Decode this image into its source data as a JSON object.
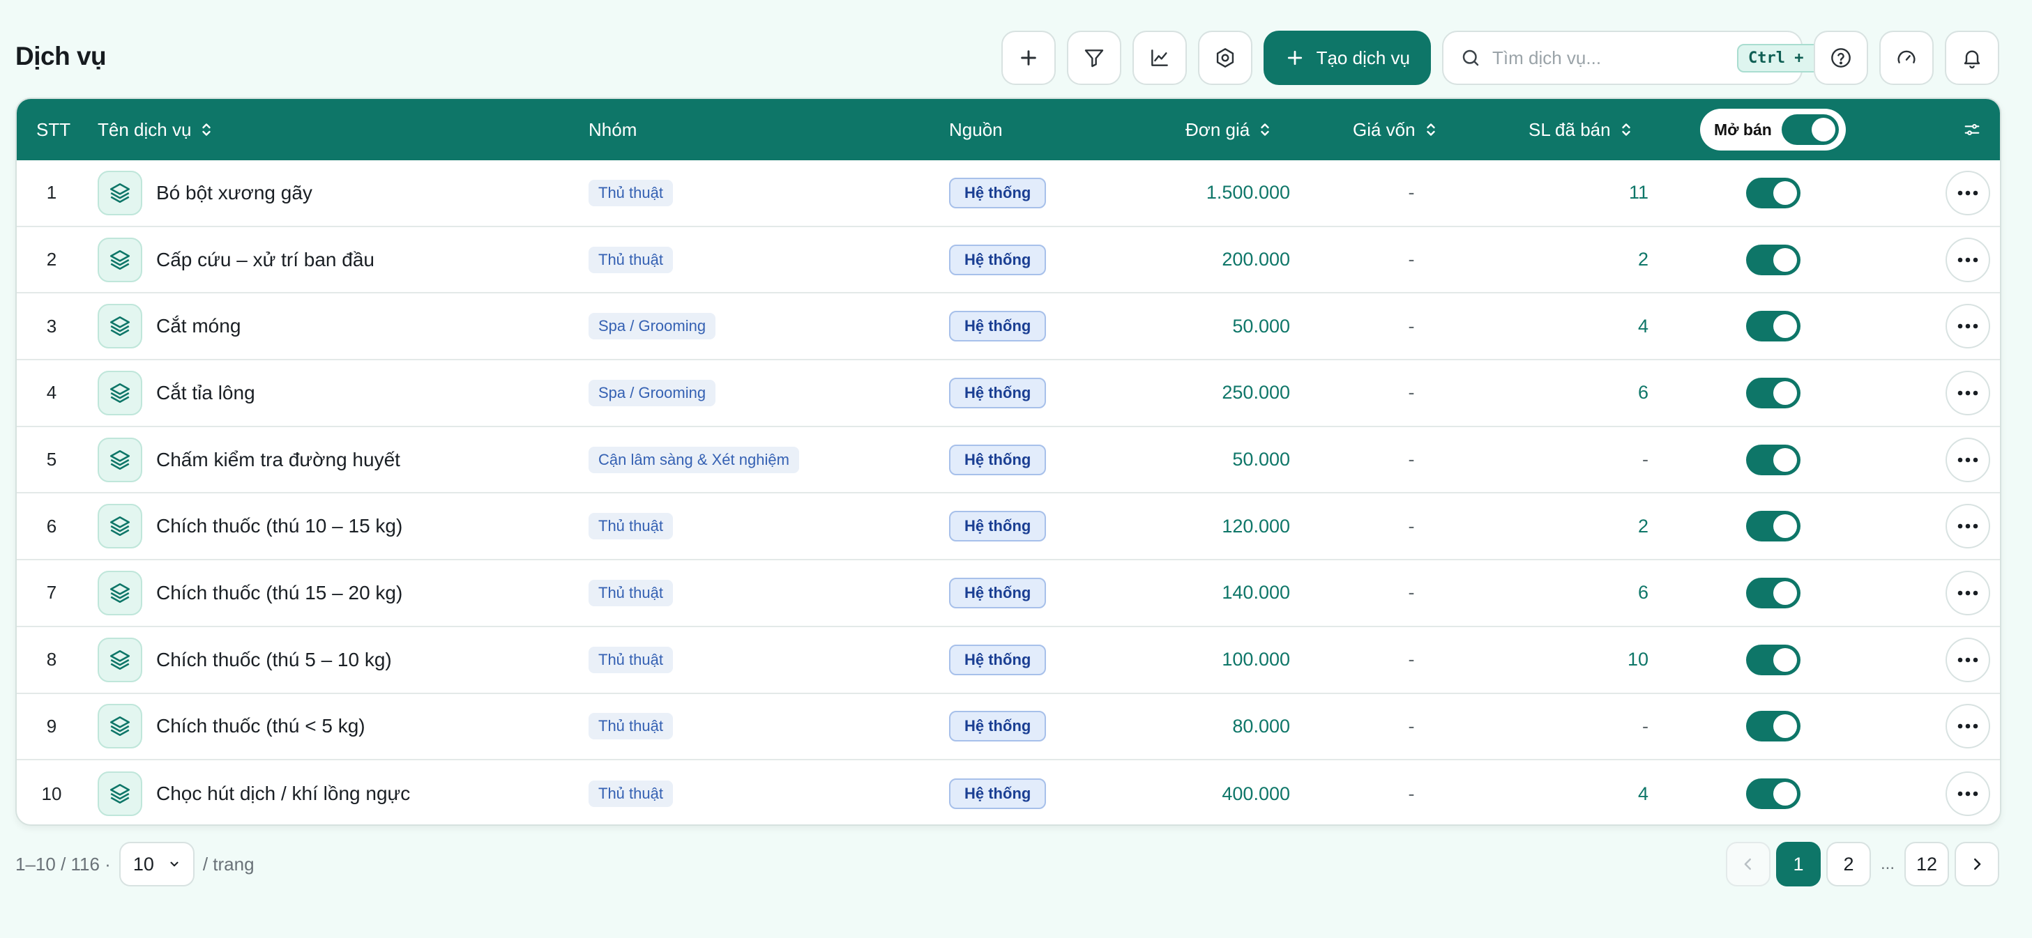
{
  "page": {
    "title": "Dịch vụ"
  },
  "toolbar": {
    "add_icon": "plus-icon",
    "filter_icon": "filter-icon",
    "chart_icon": "line-chart-icon",
    "settings_icon": "settings-hex-icon",
    "create_label": "Tạo dịch vụ",
    "search_placeholder": "Tìm dịch vụ...",
    "search_shortcut": "Ctrl + K",
    "help_icon": "help-circle-icon",
    "gauge_icon": "gauge-icon",
    "bell_icon": "bell-icon"
  },
  "table": {
    "headers": {
      "stt": "STT",
      "name": "Tên dịch vụ",
      "group": "Nhóm",
      "source": "Nguồn",
      "price": "Đơn giá",
      "cost": "Giá vốn",
      "sold": "SL đã bán",
      "open": "Mở bán"
    },
    "rows": [
      {
        "stt": "1",
        "name": "Bó bột xương gãy",
        "group": "Thủ thuật",
        "source": "Hệ thống",
        "price": "1.500.000",
        "cost": "-",
        "sold": "11",
        "open": true
      },
      {
        "stt": "2",
        "name": "Cấp cứu – xử trí ban đầu",
        "group": "Thủ thuật",
        "source": "Hệ thống",
        "price": "200.000",
        "cost": "-",
        "sold": "2",
        "open": true
      },
      {
        "stt": "3",
        "name": "Cắt móng",
        "group": "Spa / Grooming",
        "source": "Hệ thống",
        "price": "50.000",
        "cost": "-",
        "sold": "4",
        "open": true
      },
      {
        "stt": "4",
        "name": "Cắt tỉa lông",
        "group": "Spa / Grooming",
        "source": "Hệ thống",
        "price": "250.000",
        "cost": "-",
        "sold": "6",
        "open": true
      },
      {
        "stt": "5",
        "name": "Chấm kiểm tra đường huyết",
        "group": "Cận lâm sàng & Xét nghiệm",
        "source": "Hệ thống",
        "price": "50.000",
        "cost": "-",
        "sold": "-",
        "open": true
      },
      {
        "stt": "6",
        "name": "Chích thuốc (thú 10 – 15 kg)",
        "group": "Thủ thuật",
        "source": "Hệ thống",
        "price": "120.000",
        "cost": "-",
        "sold": "2",
        "open": true
      },
      {
        "stt": "7",
        "name": "Chích thuốc (thú 15 – 20 kg)",
        "group": "Thủ thuật",
        "source": "Hệ thống",
        "price": "140.000",
        "cost": "-",
        "sold": "6",
        "open": true
      },
      {
        "stt": "8",
        "name": "Chích thuốc (thú 5 – 10 kg)",
        "group": "Thủ thuật",
        "source": "Hệ thống",
        "price": "100.000",
        "cost": "-",
        "sold": "10",
        "open": true
      },
      {
        "stt": "9",
        "name": "Chích thuốc (thú < 5 kg)",
        "group": "Thủ thuật",
        "source": "Hệ thống",
        "price": "80.000",
        "cost": "-",
        "sold": "-",
        "open": true
      },
      {
        "stt": "10",
        "name": "Chọc hút dịch / khí lồng ngực",
        "group": "Thủ thuật",
        "source": "Hệ thống",
        "price": "400.000",
        "cost": "-",
        "sold": "4",
        "open": true
      }
    ]
  },
  "footer": {
    "range": "1–10 / 116 ·",
    "page_size": "10",
    "per_page": "/ trang",
    "pages": [
      "1",
      "2",
      "...",
      "12"
    ],
    "current_page": "1"
  },
  "colors": {
    "primary": "#0e7668",
    "background": "#f1fbf8"
  }
}
